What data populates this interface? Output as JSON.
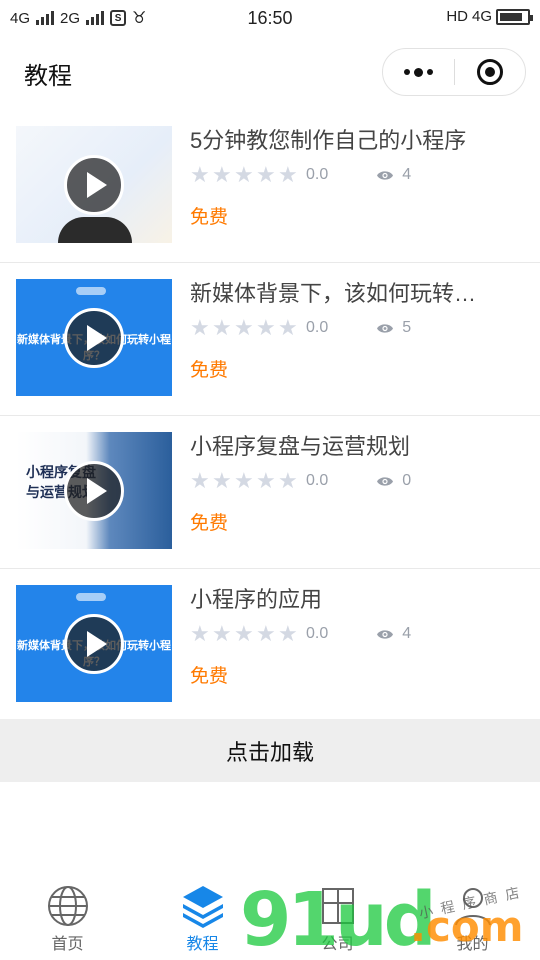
{
  "status_bar": {
    "net1": "4G",
    "net2": "2G",
    "time": "16:50",
    "hd": "HD",
    "net3": "4G"
  },
  "header": {
    "title": "教程"
  },
  "courses": [
    {
      "title": "5分钟教您制作自己的小程序",
      "rating": "0.0",
      "views": "4",
      "price": "免费",
      "thumb_caption": ""
    },
    {
      "title": "新媒体背景下，该如何玩转…",
      "rating": "0.0",
      "views": "5",
      "price": "免费",
      "thumb_caption": "新媒体背景下，该如何玩转小程序？"
    },
    {
      "title": "小程序复盘与运营规划",
      "rating": "0.0",
      "views": "0",
      "price": "免费",
      "thumb_caption": "小程序复盘\n与运营规划"
    },
    {
      "title": "小程序的应用",
      "rating": "0.0",
      "views": "4",
      "price": "免费",
      "thumb_caption": "新媒体背景下，该如何玩转小程序？"
    }
  ],
  "load_more": "点击加载",
  "tabs": [
    {
      "label": "首页",
      "icon": "globe-icon"
    },
    {
      "label": "教程",
      "icon": "layers-icon"
    },
    {
      "label": "公司",
      "icon": "building-icon"
    },
    {
      "label": "我的",
      "icon": "person-icon"
    }
  ],
  "watermark": {
    "big": "91ud",
    "com": ".com",
    "small": "小程序商店"
  },
  "colors": {
    "accent": "#1787e8",
    "price": "#ff7a00",
    "thumb_blue": "#2384ea"
  }
}
